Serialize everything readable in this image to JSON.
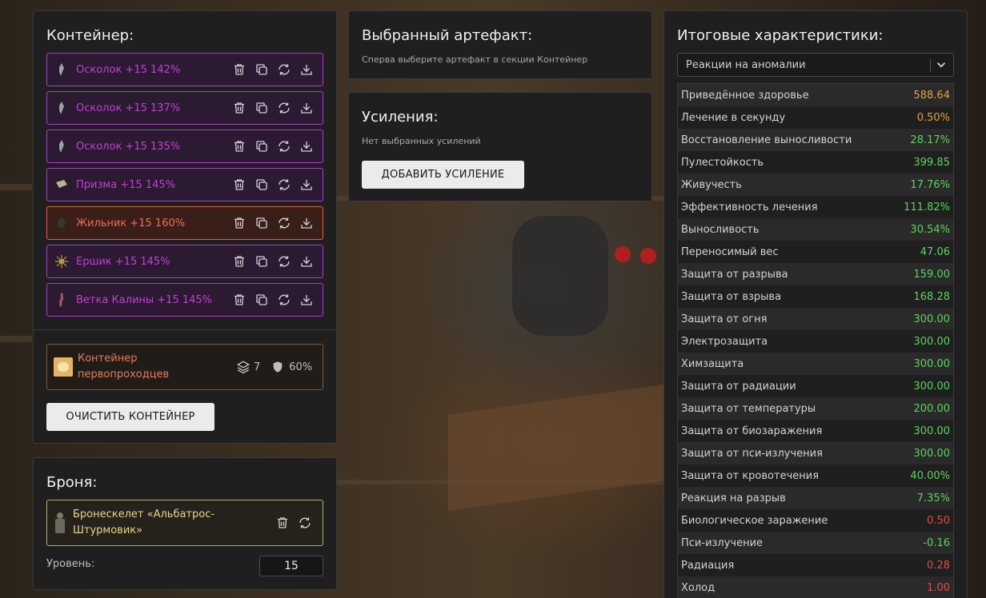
{
  "container_panel": {
    "title": "Контейнер:",
    "artifacts": [
      {
        "name": "Осколок +15 142%",
        "icon": "shard-icon",
        "color": "#c33fd6"
      },
      {
        "name": "Осколок +15 137%",
        "icon": "shard-icon",
        "color": "#c33fd6"
      },
      {
        "name": "Осколок +15 135%",
        "icon": "shard-icon",
        "color": "#c33fd6"
      },
      {
        "name": "Призма +15 145%",
        "icon": "prism-icon",
        "color": "#c33fd6"
      },
      {
        "name": "Жильник +15 160%",
        "icon": "vein-icon",
        "color": "#f26a5a"
      },
      {
        "name": "Ершик +15 145%",
        "icon": "spiky-icon",
        "color": "#c33fd6"
      },
      {
        "name": "Ветка Калины +15 145%",
        "icon": "branch-icon",
        "color": "#c33fd6"
      }
    ],
    "row_actions": [
      "trash-icon",
      "copy-icon",
      "refresh-icon",
      "download-icon"
    ],
    "container_item": {
      "name": "Контейнер первопроходцев",
      "slots": "7",
      "protection": "60%"
    },
    "clear_button": "ОЧИСТИТЬ КОНТЕЙНЕР"
  },
  "armor_panel": {
    "title": "Броня:",
    "armor_name": "Бронескелет «Альбатрос-Штурмовик»",
    "level_label": "Уровень:",
    "level_value": "15"
  },
  "selected_artifact_panel": {
    "title": "Выбранный артефакт:",
    "hint": "Сперва выберите артефакт в секции Контейнер"
  },
  "boosts_panel": {
    "title": "Усиления:",
    "hint": "Нет выбранных усилений",
    "add_button": "ДОБАВИТЬ УСИЛЕНИЕ"
  },
  "stats_panel": {
    "title": "Итоговые характеристики:",
    "filter_selected": "Реакции на аномалии",
    "rows": [
      {
        "label": "Приведённое здоровье",
        "value": "588.64",
        "color": "orange"
      },
      {
        "label": "Лечение в секунду",
        "value": "0.50%",
        "color": "orange"
      },
      {
        "label": "Восстановление выносливости",
        "value": "28.17%",
        "color": "green"
      },
      {
        "label": "Пулестойкость",
        "value": "399.85",
        "color": "green"
      },
      {
        "label": "Живучесть",
        "value": "17.76%",
        "color": "green"
      },
      {
        "label": "Эффективность лечения",
        "value": "111.82%",
        "color": "green"
      },
      {
        "label": "Выносливость",
        "value": "30.54%",
        "color": "green"
      },
      {
        "label": "Переносимый вес",
        "value": "47.06",
        "color": "green"
      },
      {
        "label": "Защита от разрыва",
        "value": "159.00",
        "color": "green"
      },
      {
        "label": "Защита от взрыва",
        "value": "168.28",
        "color": "green"
      },
      {
        "label": "Защита от огня",
        "value": "300.00",
        "color": "green"
      },
      {
        "label": "Электрозащита",
        "value": "300.00",
        "color": "green"
      },
      {
        "label": "Химзащита",
        "value": "300.00",
        "color": "green"
      },
      {
        "label": "Защита от радиации",
        "value": "300.00",
        "color": "green"
      },
      {
        "label": "Защита от температуры",
        "value": "200.00",
        "color": "green"
      },
      {
        "label": "Защита от биозаражения",
        "value": "300.00",
        "color": "green"
      },
      {
        "label": "Защита от пси-излучения",
        "value": "300.00",
        "color": "green"
      },
      {
        "label": "Защита от кровотечения",
        "value": "40.00%",
        "color": "green"
      },
      {
        "label": "Реакция на разрыв",
        "value": "7.35%",
        "color": "green"
      },
      {
        "label": "Биологическое заражение",
        "value": "0.50",
        "color": "red"
      },
      {
        "label": "Пси-излучение",
        "value": "-0.16",
        "color": "green"
      },
      {
        "label": "Радиация",
        "value": "0.28",
        "color": "red"
      },
      {
        "label": "Холод",
        "value": "1.00",
        "color": "red"
      }
    ]
  }
}
